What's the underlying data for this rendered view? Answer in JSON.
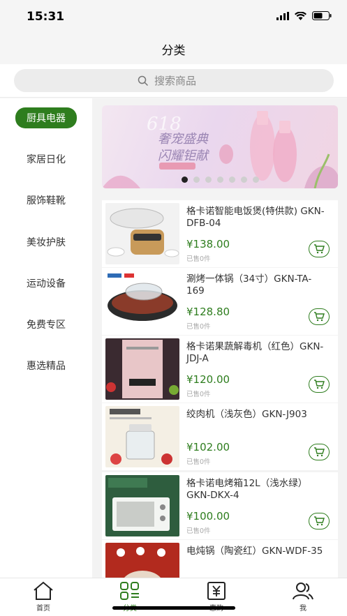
{
  "status_bar": {
    "time": "15:31"
  },
  "header": {
    "title": "分类"
  },
  "search": {
    "placeholder": "搜索商品"
  },
  "sidebar": {
    "items": [
      {
        "label": "厨具电器",
        "active": true
      },
      {
        "label": "家居日化",
        "active": false
      },
      {
        "label": "服饰鞋靴",
        "active": false
      },
      {
        "label": "美妆护肤",
        "active": false
      },
      {
        "label": "运动设备",
        "active": false
      },
      {
        "label": "免费专区",
        "active": false
      },
      {
        "label": "惠选精品",
        "active": false
      }
    ]
  },
  "banner": {
    "line1": "奢宠盛典",
    "line2": "闪耀钜献",
    "badge": "618",
    "dot_count": 7,
    "active_dot": 0
  },
  "products": [
    {
      "name": "格卡诺智能电饭煲(特供款) GKN-DFB-04",
      "price": "¥138.00",
      "sold": "已售0件"
    },
    {
      "name": "涮烤一体锅（34寸）GKN-TA-169",
      "price": "¥128.80",
      "sold": "已售0件"
    },
    {
      "name": "格卡诺果蔬解毒机（红色）GKN-JDJ-A",
      "price": "¥120.00",
      "sold": "已售0件"
    },
    {
      "name": "绞肉机（浅灰色）GKN-J903",
      "price": "¥102.00",
      "sold": "已售0件"
    },
    {
      "name": "格卡诺电烤箱12L（浅水绿）GKN-DKX-4",
      "price": "¥100.00",
      "sold": "已售0件"
    },
    {
      "name": "电炖锅（陶瓷红）GKN-WDF-35",
      "price": "",
      "sold": ""
    }
  ],
  "tabbar": {
    "items": [
      {
        "label": "首页",
        "icon": "home-icon",
        "active": false
      },
      {
        "label": "分类",
        "icon": "category-icon",
        "active": true
      },
      {
        "label": "惠购",
        "icon": "yen-icon",
        "active": false
      },
      {
        "label": "我",
        "icon": "user-icon",
        "active": false
      }
    ]
  },
  "colors": {
    "accent": "#2e7d1e"
  }
}
